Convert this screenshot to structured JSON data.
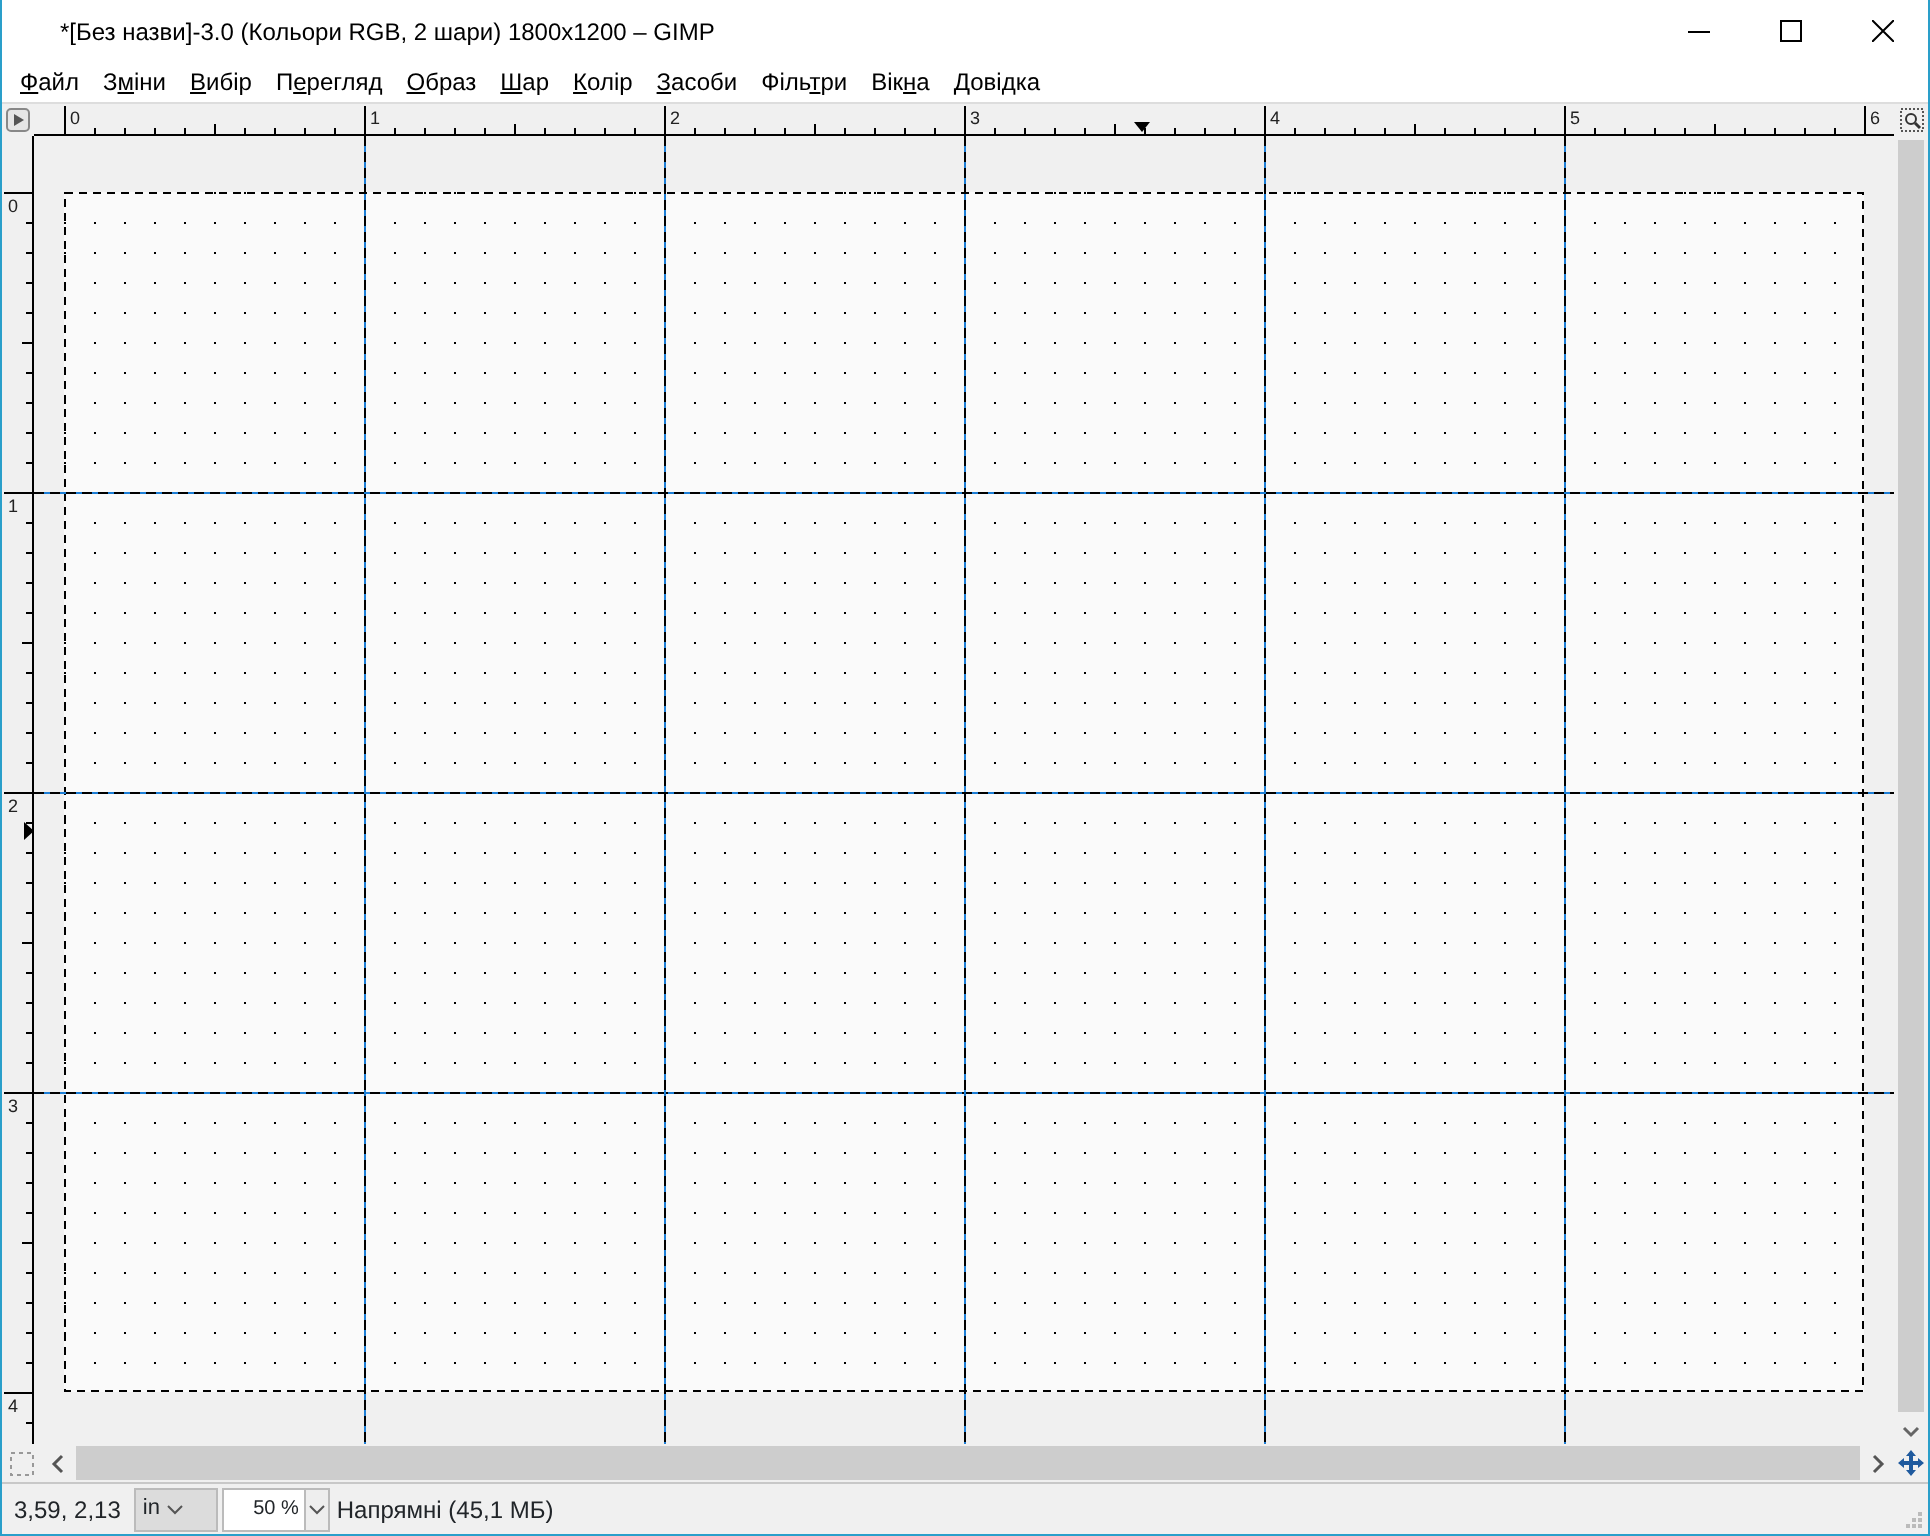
{
  "window": {
    "title": "*[Без назви]-3.0 (Кольори RGB, 2 шари) 1800x1200 – GIMP"
  },
  "menu": [
    {
      "mnemonic": "Ф",
      "after": "айл"
    },
    {
      "before": "З",
      "mnemonic": "м",
      "after": "іни"
    },
    {
      "mnemonic": "В",
      "after": "ибір"
    },
    {
      "before": "П",
      "mnemonic": "е",
      "after": "регляд"
    },
    {
      "mnemonic": "О",
      "after": "браз"
    },
    {
      "mnemonic": "Ш",
      "after": "ар"
    },
    {
      "mnemonic": "К",
      "after": "олір"
    },
    {
      "mnemonic": "З",
      "after": "асоби"
    },
    {
      "before": "Філь",
      "mnemonic": "т",
      "after": "ри"
    },
    {
      "before": "Вік",
      "mnemonic": "н",
      "after": "а"
    },
    {
      "mnemonic": "Д",
      "after": "овідка"
    }
  ],
  "rulers": {
    "horizontal": [
      "0",
      "1",
      "2",
      "3",
      "4",
      "5",
      "6"
    ],
    "vertical": [
      "0",
      "1",
      "2",
      "3",
      "4"
    ]
  },
  "status_bar": {
    "pointer": "3,59, 2,13",
    "unit": "in",
    "zoom": "50 %",
    "message": "Напрямні (45,1 МБ)"
  }
}
